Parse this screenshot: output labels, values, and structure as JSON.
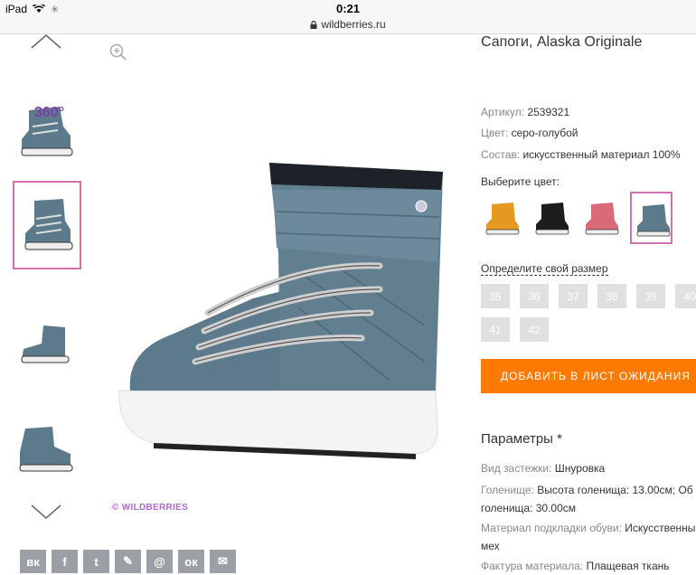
{
  "status_bar": {
    "device": "iPad",
    "time": "0:21",
    "url": "wildberries.ru"
  },
  "product": {
    "title": "Сапоги, Alaska Originale",
    "article_label": "Артикул:",
    "article_value": "2539321",
    "color_label": "Цвет:",
    "color_value": "серо-голубой",
    "composition_label": "Состав:",
    "composition_value": "искусственный материал 100%",
    "choose_color_label": "Выберите цвет:",
    "color_options": [
      {
        "name": "orange-boot",
        "color": "#e39a1f"
      },
      {
        "name": "black-boot",
        "color": "#1d1d1d"
      },
      {
        "name": "pink-boot",
        "color": "#d96a78"
      },
      {
        "name": "gray-blue-boot",
        "color": "#5d7a8c"
      }
    ],
    "size_link": "Определите свой размер",
    "sizes": [
      "35",
      "36",
      "37",
      "38",
      "39",
      "40",
      "41",
      "42"
    ],
    "wishlist_button": "ДОБАВИТЬ В ЛИСТ ОЖИДАНИЯ",
    "watermark": "© WILDBERRIES",
    "badge_360": "360°"
  },
  "params": {
    "heading": "Параметры *",
    "rows": [
      {
        "key": "Вид застежки:",
        "value": "Шнуровка"
      },
      {
        "key": "Голенище:",
        "value": "Высота голенища: 13.00см; Об"
      },
      {
        "key": "",
        "value": "голенища: 30.00см"
      },
      {
        "key": "Материал подкладки обуви:",
        "value": "Искусственны"
      },
      {
        "key": "",
        "value": "мех"
      },
      {
        "key": "Фактура материала:",
        "value": "Плащевая ткань"
      }
    ]
  },
  "social": [
    "вк",
    "f",
    "t",
    "✎",
    "@",
    "ок",
    "✉"
  ],
  "colors": {
    "accent_orange": "#ff7a00",
    "selection_pink": "#d46fb2",
    "size_gray": "#e0e0e0",
    "boot_blue": "#5d7a8c"
  }
}
